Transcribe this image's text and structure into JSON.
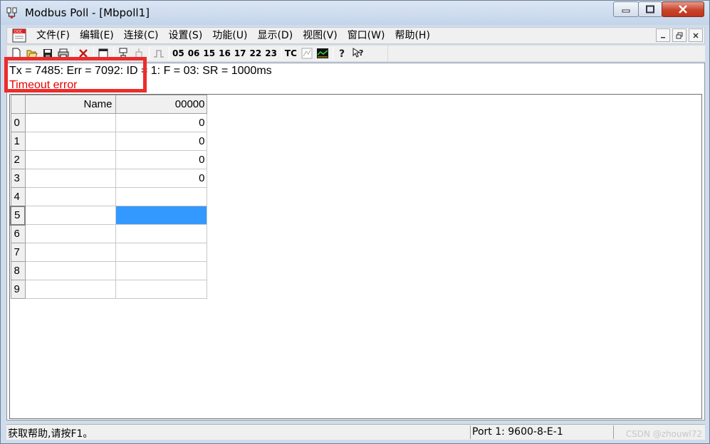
{
  "window": {
    "title": "Modbus Poll - [Mbpoll1]"
  },
  "menubar": {
    "items": [
      "文件(F)",
      "编辑(E)",
      "连接(C)",
      "设置(S)",
      "功能(U)",
      "显示(D)",
      "视图(V)",
      "窗口(W)",
      "帮助(H)"
    ]
  },
  "toolbar": {
    "function_codes": [
      "05",
      "06",
      "15",
      "16",
      "17",
      "22",
      "23"
    ],
    "tc_label": "TC"
  },
  "status": {
    "line1": "Tx = 7485: Err = 7092: ID = 1: F = 03: SR = 1000ms",
    "error": "Timeout error"
  },
  "grid": {
    "name_header": "Name",
    "address_header": "00000",
    "rows": [
      {
        "index": "0",
        "name": "",
        "value": "0"
      },
      {
        "index": "1",
        "name": "",
        "value": "0"
      },
      {
        "index": "2",
        "name": "",
        "value": "0"
      },
      {
        "index": "3",
        "name": "",
        "value": "0"
      },
      {
        "index": "4",
        "name": "",
        "value": ""
      },
      {
        "index": "5",
        "name": "",
        "value": ""
      },
      {
        "index": "6",
        "name": "",
        "value": ""
      },
      {
        "index": "7",
        "name": "",
        "value": ""
      },
      {
        "index": "8",
        "name": "",
        "value": ""
      },
      {
        "index": "9",
        "name": "",
        "value": ""
      }
    ],
    "selected_color": "#3399ff"
  },
  "statusbar": {
    "help_text": "获取帮助,请按F1。",
    "port_info": "Port 1: 9600-8-E-1"
  },
  "watermark": "CSDN @zhouwl72",
  "colors": {
    "error_text": "#e80000",
    "highlight_box": "#ec2c2c"
  }
}
